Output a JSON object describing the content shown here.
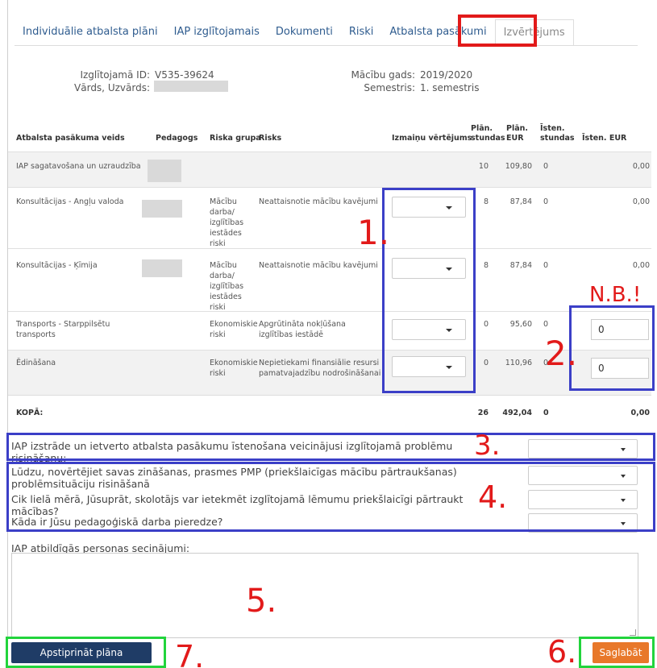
{
  "tabs": [
    {
      "label": "Individuālie atbalsta plāni"
    },
    {
      "label": "IAP izglītojamais"
    },
    {
      "label": "Dokumenti"
    },
    {
      "label": "Riski"
    },
    {
      "label": "Atbalsta pasākumi"
    },
    {
      "label": "Izvērtējums"
    }
  ],
  "info": {
    "student_id_label": "Izglītojamā ID:",
    "student_id_value": "V535-39624",
    "name_label": "Vārds, Uzvārds:",
    "school_year_label": "Mācību gads:",
    "school_year_value": "2019/2020",
    "semester_label": "Semestris:",
    "semester_value": "1. semestris"
  },
  "table": {
    "headers": {
      "type": "Atbalsta pasākuma veids",
      "teacher": "Pedagogs",
      "risk_group": "Riska grupa",
      "risk": "Risks",
      "change_eval": "Izmaiņu vērtējums",
      "plan_hours": "Plān. stundas",
      "plan_eur": "Plān. EUR",
      "actual_hours": "Īsten. stundas",
      "actual_eur": "Īsten. EUR"
    },
    "rows": [
      {
        "type": "IAP sagatavošana un uzraudzība",
        "risk_group": "",
        "risk": "",
        "plan_hours": "10",
        "plan_eur": "109,80",
        "actual_hours": "0",
        "actual_eur": "0,00"
      },
      {
        "type": "Konsultācijas - Angļu valoda",
        "risk_group": "Mācību darba/ izglītības iestādes riski",
        "risk": "Neattaisnotie mācību kavējumi",
        "plan_hours": "8",
        "plan_eur": "87,84",
        "actual_hours": "0",
        "actual_eur": "0,00"
      },
      {
        "type": "Konsultācijas - Ķīmija",
        "risk_group": "Mācību darba/ izglītības iestādes riski",
        "risk": "Neattaisnotie mācību kavējumi",
        "plan_hours": "8",
        "plan_eur": "87,84",
        "actual_hours": "0",
        "actual_eur": "0,00"
      },
      {
        "type": "Transports - Starppilsētu transports",
        "risk_group": "Ekonomiskie riski",
        "risk": "Apgrūtināta nokļūšana izglītības iestādē",
        "plan_hours": "0",
        "plan_eur": "95,60",
        "actual_hours": "0",
        "actual_eur_input": "0"
      },
      {
        "type": "Ēdināšana",
        "risk_group": "Ekonomiskie riski",
        "risk": "Nepietiekami finansiālie resursi pamatvajadzību nodrošināšanai",
        "plan_hours": "0",
        "plan_eur": "110,96",
        "actual_hours": "0",
        "actual_eur_input": "0"
      }
    ],
    "total": {
      "label": "KOPĀ:",
      "plan_hours": "26",
      "plan_eur": "492,04",
      "actual_hours": "0",
      "actual_eur": "0,00"
    }
  },
  "questions": {
    "q1": "IAP izstrāde un ietverto atbalsta pasākumu īstenošana veicinājusi izglītojamā problēmu risināšanu:",
    "q2": "Lūdzu, novērtējiet savas zināšanas, prasmes PMP (priekšlaicīgas mācību pārtraukšanas) problēmsituāciju risināšanā",
    "q3": "Cik lielā mērā, Jūsuprāt, skolotājs var ietekmēt izglītojamā lēmumu priekšlaicīgi pārtraukt mācības?",
    "q4": "Kāda ir Jūsu pedagoģiskā darba pieredze?"
  },
  "conclusions_label": "IAP atbildīgās personas secinājumi:",
  "buttons": {
    "confirm": "Apstiprināt plāna noslēgšanu",
    "save": "Saglabāt"
  },
  "annotations": {
    "n1": "1.",
    "n2": "2.",
    "n3": "3.",
    "n4": "4.",
    "n5": "5.",
    "n6": "6.",
    "n7": "7.",
    "nb": "N.B.!"
  },
  "colors": {
    "accent_link": "#2f5c8f",
    "confirm_button": "#1f3c66",
    "save_button": "#e8782a",
    "annotation_red": "#e21a1a",
    "annotation_blue": "#3b3fc7",
    "annotation_green": "#22d43c"
  }
}
